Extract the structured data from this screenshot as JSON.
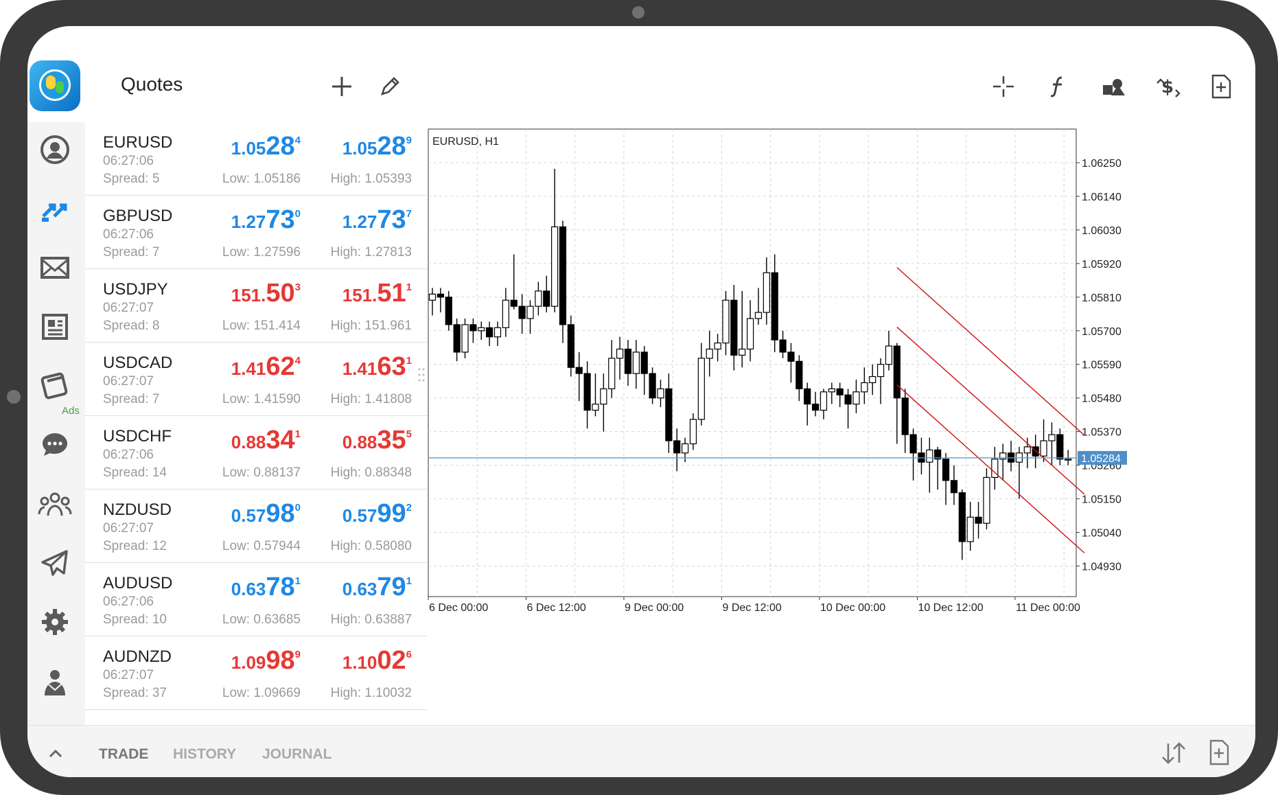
{
  "header": {
    "title": "Quotes"
  },
  "quotes": [
    {
      "symbol": "EURUSD",
      "time": "06:27:06",
      "spread": "Spread: 5",
      "bid": {
        "small": "1.05",
        "big": "28",
        "sup": "4"
      },
      "ask": {
        "small": "1.05",
        "big": "28",
        "sup": "9"
      },
      "low": "Low: 1.05186",
      "high": "High: 1.05393",
      "color": "#1e88e5"
    },
    {
      "symbol": "GBPUSD",
      "time": "06:27:06",
      "spread": "Spread: 7",
      "bid": {
        "small": "1.27",
        "big": "73",
        "sup": "0"
      },
      "ask": {
        "small": "1.27",
        "big": "73",
        "sup": "7"
      },
      "low": "Low: 1.27596",
      "high": "High: 1.27813",
      "color": "#1e88e5"
    },
    {
      "symbol": "USDJPY",
      "time": "06:27:07",
      "spread": "Spread: 8",
      "bid": {
        "small": "151.",
        "big": "50",
        "sup": "3"
      },
      "ask": {
        "small": "151.",
        "big": "51",
        "sup": "1"
      },
      "low": "Low: 151.414",
      "high": "High: 151.961",
      "color": "#e53935"
    },
    {
      "symbol": "USDCAD",
      "time": "06:27:07",
      "spread": "Spread: 7",
      "bid": {
        "small": "1.41",
        "big": "62",
        "sup": "4"
      },
      "ask": {
        "small": "1.41",
        "big": "63",
        "sup": "1"
      },
      "low": "Low: 1.41590",
      "high": "High: 1.41808",
      "color": "#e53935"
    },
    {
      "symbol": "USDCHF",
      "time": "06:27:06",
      "spread": "Spread: 14",
      "bid": {
        "small": "0.88",
        "big": "34",
        "sup": "1"
      },
      "ask": {
        "small": "0.88",
        "big": "35",
        "sup": "5"
      },
      "low": "Low: 0.88137",
      "high": "High: 0.88348",
      "color": "#e53935"
    },
    {
      "symbol": "NZDUSD",
      "time": "06:27:07",
      "spread": "Spread: 12",
      "bid": {
        "small": "0.57",
        "big": "98",
        "sup": "0"
      },
      "ask": {
        "small": "0.57",
        "big": "99",
        "sup": "2"
      },
      "low": "Low: 0.57944",
      "high": "High: 0.58080",
      "color": "#1e88e5"
    },
    {
      "symbol": "AUDUSD",
      "time": "06:27:06",
      "spread": "Spread: 10",
      "bid": {
        "small": "0.63",
        "big": "78",
        "sup": "1"
      },
      "ask": {
        "small": "0.63",
        "big": "79",
        "sup": "1"
      },
      "low": "Low: 0.63685",
      "high": "High: 0.63887",
      "color": "#1e88e5"
    },
    {
      "symbol": "AUDNZD",
      "time": "06:27:07",
      "spread": "Spread: 37",
      "bid": {
        "small": "1.09",
        "big": "98",
        "sup": "9"
      },
      "ask": {
        "small": "1.10",
        "big": "02",
        "sup": "6"
      },
      "low": "Low: 1.09669",
      "high": "High: 1.10032",
      "color": "#e53935"
    }
  ],
  "sidebar": {
    "ads_label": "Ads"
  },
  "chart_data": {
    "type": "candlestick",
    "title": "EURUSD, H1",
    "y_ticks": [
      "1.06250",
      "1.06140",
      "1.06030",
      "1.05920",
      "1.05810",
      "1.05700",
      "1.05590",
      "1.05480",
      "1.05370",
      "1.05260",
      "1.05150",
      "1.05040",
      "1.04930"
    ],
    "ylim": [
      1.0483,
      1.0636
    ],
    "x_ticks": [
      "6 Dec 00:00",
      "6 Dec 12:00",
      "9 Dec 00:00",
      "9 Dec 12:00",
      "10 Dec 00:00",
      "10 Dec 12:00",
      "11 Dec 00:00"
    ],
    "current_price": "1.05284",
    "current_price_value": 1.05284,
    "candles": [
      [
        1.058,
        1.0584,
        1.0575,
        1.0582
      ],
      [
        1.0582,
        1.0584,
        1.0576,
        1.0581
      ],
      [
        1.0581,
        1.0583,
        1.057,
        1.0572
      ],
      [
        1.0572,
        1.0574,
        1.056,
        1.0563
      ],
      [
        1.0563,
        1.0574,
        1.0561,
        1.0572
      ],
      [
        1.0572,
        1.0574,
        1.0566,
        1.057
      ],
      [
        1.057,
        1.0573,
        1.0567,
        1.0571
      ],
      [
        1.0571,
        1.0573,
        1.0565,
        1.0568
      ],
      [
        1.0568,
        1.0573,
        1.0565,
        1.0571
      ],
      [
        1.0571,
        1.0584,
        1.0568,
        1.058
      ],
      [
        1.058,
        1.0595,
        1.0577,
        1.0578
      ],
      [
        1.0578,
        1.0582,
        1.0569,
        1.0574
      ],
      [
        1.0574,
        1.058,
        1.0569,
        1.0578
      ],
      [
        1.0578,
        1.0586,
        1.0575,
        1.0583
      ],
      [
        1.0583,
        1.0588,
        1.0576,
        1.0578
      ],
      [
        1.0578,
        1.0623,
        1.0576,
        1.0604
      ],
      [
        1.0604,
        1.0606,
        1.0566,
        1.0572
      ],
      [
        1.0572,
        1.0575,
        1.0555,
        1.0558
      ],
      [
        1.0558,
        1.0563,
        1.0547,
        1.0556
      ],
      [
        1.0556,
        1.056,
        1.0538,
        1.0544
      ],
      [
        1.0544,
        1.0556,
        1.0542,
        1.0546
      ],
      [
        1.0546,
        1.0556,
        1.0537,
        1.0551
      ],
      [
        1.0551,
        1.0567,
        1.0548,
        1.0561
      ],
      [
        1.0561,
        1.0568,
        1.0554,
        1.0564
      ],
      [
        1.0564,
        1.0567,
        1.0552,
        1.0556
      ],
      [
        1.0556,
        1.0567,
        1.0551,
        1.0563
      ],
      [
        1.0563,
        1.0565,
        1.0549,
        1.0556
      ],
      [
        1.0556,
        1.0558,
        1.0546,
        1.0548
      ],
      [
        1.0548,
        1.0554,
        1.0545,
        1.0551
      ],
      [
        1.0551,
        1.0556,
        1.053,
        1.0534
      ],
      [
        1.0534,
        1.0538,
        1.0524,
        1.053
      ],
      [
        1.053,
        1.0535,
        1.0527,
        1.0533
      ],
      [
        1.0533,
        1.0543,
        1.0531,
        1.0541
      ],
      [
        1.0541,
        1.0566,
        1.0539,
        1.0561
      ],
      [
        1.0561,
        1.057,
        1.0555,
        1.0564
      ],
      [
        1.0564,
        1.0569,
        1.056,
        1.0566
      ],
      [
        1.0566,
        1.0583,
        1.0562,
        1.058
      ],
      [
        1.058,
        1.0585,
        1.0557,
        1.0562
      ],
      [
        1.0562,
        1.0583,
        1.0558,
        1.0564
      ],
      [
        1.0564,
        1.058,
        1.056,
        1.0574
      ],
      [
        1.0574,
        1.0584,
        1.0572,
        1.0576
      ],
      [
        1.0576,
        1.0594,
        1.0572,
        1.0589
      ],
      [
        1.0589,
        1.0595,
        1.0563,
        1.0567
      ],
      [
        1.0567,
        1.057,
        1.0561,
        1.0563
      ],
      [
        1.0563,
        1.0566,
        1.0553,
        1.056
      ],
      [
        1.056,
        1.0562,
        1.0547,
        1.0551
      ],
      [
        1.0551,
        1.0553,
        1.0539,
        1.0546
      ],
      [
        1.0546,
        1.055,
        1.0542,
        1.0544
      ],
      [
        1.0544,
        1.0551,
        1.0541,
        1.055
      ],
      [
        1.055,
        1.0553,
        1.0546,
        1.0551
      ],
      [
        1.0551,
        1.0553,
        1.0545,
        1.0549
      ],
      [
        1.0549,
        1.0551,
        1.0538,
        1.0546
      ],
      [
        1.0546,
        1.0554,
        1.0543,
        1.055
      ],
      [
        1.055,
        1.0558,
        1.0546,
        1.0553
      ],
      [
        1.0553,
        1.0559,
        1.0549,
        1.0555
      ],
      [
        1.0555,
        1.0561,
        1.0546,
        1.0559
      ],
      [
        1.0559,
        1.057,
        1.0557,
        1.0565
      ],
      [
        1.0565,
        1.0566,
        1.0533,
        1.0548
      ],
      [
        1.0548,
        1.0551,
        1.053,
        1.0536
      ],
      [
        1.0536,
        1.0538,
        1.0521,
        1.053
      ],
      [
        1.053,
        1.0535,
        1.0523,
        1.0527
      ],
      [
        1.0527,
        1.0535,
        1.0517,
        1.0531
      ],
      [
        1.0531,
        1.0532,
        1.0518,
        1.0528
      ],
      [
        1.0528,
        1.053,
        1.0513,
        1.0521
      ],
      [
        1.0521,
        1.0526,
        1.0513,
        1.0517
      ],
      [
        1.0517,
        1.0518,
        1.0495,
        1.0501
      ],
      [
        1.0501,
        1.0514,
        1.0498,
        1.0509
      ],
      [
        1.0509,
        1.0514,
        1.0502,
        1.0507
      ],
      [
        1.0507,
        1.0525,
        1.0505,
        1.0522
      ],
      [
        1.0522,
        1.0532,
        1.0518,
        1.0528
      ],
      [
        1.0528,
        1.0533,
        1.0521,
        1.053
      ],
      [
        1.053,
        1.0534,
        1.0524,
        1.0527
      ],
      [
        1.0527,
        1.0532,
        1.0515,
        1.053
      ],
      [
        1.053,
        1.0535,
        1.0525,
        1.0532
      ],
      [
        1.0532,
        1.0536,
        1.0525,
        1.0529
      ],
      [
        1.0529,
        1.0541,
        1.0527,
        1.0534
      ],
      [
        1.0534,
        1.054,
        1.0526,
        1.0536
      ],
      [
        1.0536,
        1.0538,
        1.0526,
        1.0528
      ],
      [
        1.0528,
        1.0531,
        1.0526,
        1.0528
      ]
    ],
    "channel_lines": [
      {
        "from": [
          57,
          1.05907
        ],
        "to": [
          80,
          1.05358
        ],
        "color": "#cc1111"
      },
      {
        "from": [
          57,
          1.05712
        ],
        "to": [
          80,
          1.05165
        ],
        "color": "#cc1111"
      },
      {
        "from": [
          57,
          1.05523
        ],
        "to": [
          80,
          1.04973
        ],
        "color": "#cc1111"
      }
    ]
  },
  "bottom_tabs": [
    {
      "label": "TRADE",
      "active": true
    },
    {
      "label": "HISTORY",
      "active": false
    },
    {
      "label": "JOURNAL",
      "active": false
    }
  ]
}
